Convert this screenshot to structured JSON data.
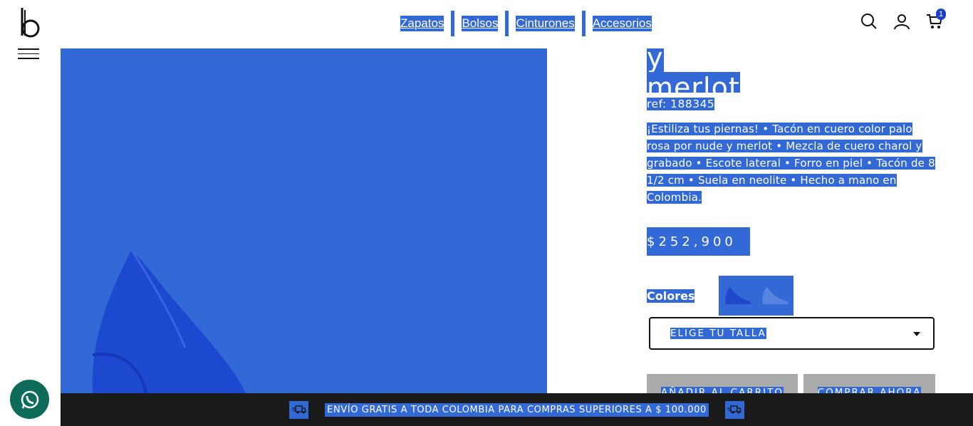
{
  "header": {
    "logo_alt": "b",
    "nav": [
      {
        "label": "Zapatos"
      },
      {
        "label": "Bolsos"
      },
      {
        "label": "Cinturones"
      },
      {
        "label": "Accesorios"
      }
    ],
    "icons": [
      "search-icon",
      "user-icon",
      "cart-icon"
    ],
    "cart_count": "1"
  },
  "product": {
    "title_line1": "palo rosa por nude y",
    "title_line2": "merlot",
    "ref": "ref: 188345",
    "description": "¡Estiliza tus piernas! • Tacón en cuero color palo rosa por nude y merlot • Mezcla de cuero charol y grabado • Escote lateral • Forro en piel • Tacón de 8 1/2 cm • Suela en neolite • Hecho a mano en Colombia.",
    "price": "$252,900",
    "colors_label": "Colores",
    "size_placeholder": "ELIGE TU TALLA",
    "add_to_cart": "AÑADIR AL CARRITO",
    "buy_now": "COMPRAR AHORA"
  },
  "bottom_bar": {
    "text": "ENVÍO GRATIS A TODA COLOMBIA PARA COMPRAS SUPERIORES A $ 100.000"
  },
  "colors": {
    "selection": "#3369d6",
    "bar_bg": "#1a1a1a",
    "button_bg": "#aaaaaa",
    "whatsapp": "#0d6b5a"
  }
}
